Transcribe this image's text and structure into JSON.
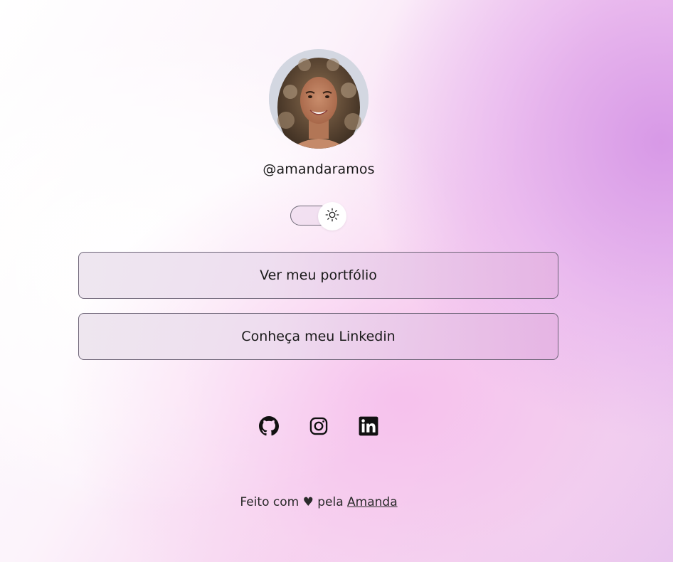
{
  "profile": {
    "avatar_alt": "Foto de perfil",
    "handle": "@amandaramos"
  },
  "theme_toggle": {
    "state": "light",
    "icon": "sun-icon"
  },
  "links": [
    {
      "label": "Ver meu portfólio"
    },
    {
      "label": "Conheça meu Linkedin"
    }
  ],
  "social": [
    {
      "icon": "github-icon"
    },
    {
      "icon": "instagram-icon"
    },
    {
      "icon": "linkedin-icon"
    }
  ],
  "footer": {
    "prefix": "Feito com ♥ pela",
    "author_link": "Amanda"
  },
  "colors": {
    "text": "#1b1b1b",
    "border": "#6d6477",
    "accent_pink": "#f6d2ef",
    "accent_purple": "#d696e6"
  }
}
